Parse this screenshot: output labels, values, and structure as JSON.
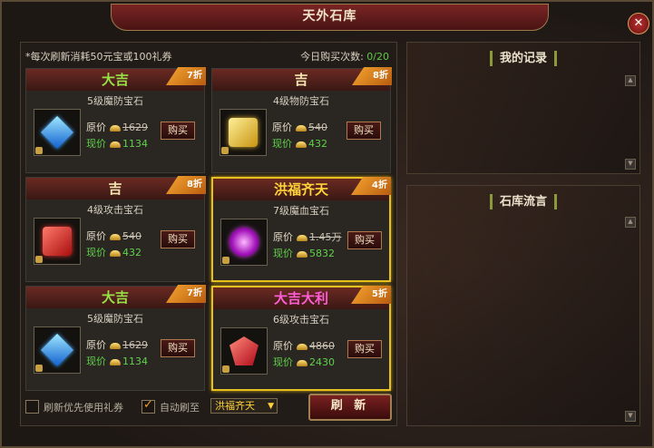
{
  "window": {
    "title": "天外石库",
    "close_label": "✕"
  },
  "info": {
    "left_text": "*每次刷新消耗50元宝或100礼券",
    "right_label": "今日购买次数:",
    "right_count": "0/20"
  },
  "labels": {
    "orig": "原价",
    "now": "现价",
    "buy": "购买"
  },
  "cards": [
    {
      "fortune": "大吉",
      "discount": "7折",
      "name": "5级魔防宝石",
      "gem": "blue-gem",
      "orig": "1629",
      "now": "1134",
      "highlight": false
    },
    {
      "fortune": "吉",
      "discount": "8折",
      "name": "4级物防宝石",
      "gem": "yellow-gem",
      "orig": "540",
      "now": "432",
      "highlight": false
    },
    {
      "fortune": "吉",
      "discount": "8折",
      "name": "4级攻击宝石",
      "gem": "red-gem",
      "orig": "540",
      "now": "432",
      "highlight": false
    },
    {
      "fortune": "洪福齐天",
      "discount": "4折",
      "name": "7级魔血宝石",
      "gem": "purple-gem",
      "orig": "1.45万",
      "now": "5832",
      "highlight": true
    },
    {
      "fortune": "大吉",
      "discount": "7折",
      "name": "5级魔防宝石",
      "gem": "blue-gem",
      "orig": "1629",
      "now": "1134",
      "highlight": false
    },
    {
      "fortune": "大吉大利",
      "discount": "5折",
      "name": "6级攻击宝石",
      "gem": "red-crystal-gem",
      "orig": "4860",
      "now": "2430",
      "highlight": true
    }
  ],
  "bottom": {
    "prefer_coupon_label": "刷新优先使用礼券",
    "prefer_coupon_checked": false,
    "auto_refresh_label": "自动刷至",
    "auto_refresh_checked": true,
    "auto_refresh_value": "洪福齐天",
    "refresh_label": "刷 新"
  },
  "records": {
    "title": "我的记录"
  },
  "messages": {
    "title": "石库流言"
  },
  "colors": {
    "accent_gold": "#e6c020",
    "price_green": "#5fd24a",
    "title_red": "#7a2424"
  }
}
